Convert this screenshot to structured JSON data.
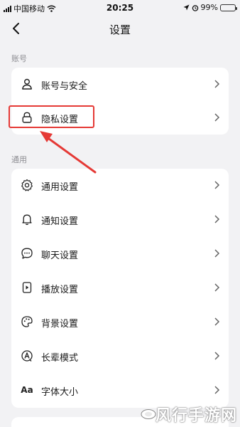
{
  "status_bar": {
    "carrier": "中国移动",
    "time": "20:25",
    "battery_percent": "99%",
    "battery_level": 0.99
  },
  "nav": {
    "title": "设置",
    "back_icon": "chevron-left-icon"
  },
  "sections": [
    {
      "label": "账号",
      "items": [
        {
          "label": "账号与安全",
          "icon": "user-icon"
        },
        {
          "label": "隐私设置",
          "icon": "lock-icon",
          "highlighted": true
        }
      ]
    },
    {
      "label": "通用",
      "items": [
        {
          "label": "通用设置",
          "icon": "gear-icon"
        },
        {
          "label": "通知设置",
          "icon": "bell-icon"
        },
        {
          "label": "聊天设置",
          "icon": "chat-bubble-icon"
        },
        {
          "label": "播放设置",
          "icon": "play-icon"
        },
        {
          "label": "背景设置",
          "icon": "palette-icon"
        },
        {
          "label": "长辈模式",
          "icon": "elder-mode-icon"
        },
        {
          "label": "字体大小",
          "icon": "font-size-icon",
          "icon_text": "Aa"
        }
      ]
    }
  ],
  "watermark": {
    "text": "风行手游网"
  },
  "colors": {
    "background": "#f2f2f4",
    "card": "#ffffff",
    "annotation_red": "#e53935",
    "battery_green": "#2fbf4a"
  }
}
